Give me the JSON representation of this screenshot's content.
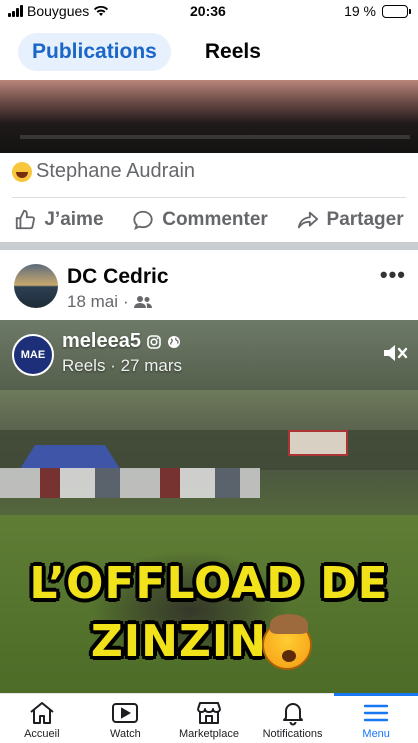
{
  "status_bar": {
    "carrier": "Bouygues",
    "time": "20:36",
    "battery_percent": "19 %",
    "battery_level": 0.19
  },
  "tabs": [
    {
      "label": "Publications",
      "active": true
    },
    {
      "label": "Reels",
      "active": false
    }
  ],
  "previous_post": {
    "reaction_emoji": "laugh-emoji",
    "reactor_name": "Stephane Audrain",
    "actions": {
      "like": "J’aime",
      "comment": "Commenter",
      "share": "Partager"
    }
  },
  "post": {
    "author": "DC Cedric",
    "date": "18 mai",
    "separator": "·",
    "audience_icon": "friends-icon",
    "more_label": "•••",
    "reel": {
      "account": "meleea5",
      "avatar_text": "MAE",
      "meta": "Reels · 27 mars",
      "overlay_line1": "L’OFFLOAD DE",
      "overlay_line2": "ZINZIN",
      "overlay_emoji": "exploding-head-emoji"
    }
  },
  "bottom_nav": [
    {
      "label": "Accueil",
      "icon": "home-icon",
      "active": false
    },
    {
      "label": "Watch",
      "icon": "video-icon",
      "active": false
    },
    {
      "label": "Marketplace",
      "icon": "store-icon",
      "active": false
    },
    {
      "label": "Notifications",
      "icon": "bell-icon",
      "active": false
    },
    {
      "label": "Menu",
      "icon": "hamburger-icon",
      "active": true
    }
  ],
  "colors": {
    "accent": "#1877f2",
    "tab_active_bg": "#e7f0fd",
    "overlay_yellow": "#f2e21a"
  }
}
